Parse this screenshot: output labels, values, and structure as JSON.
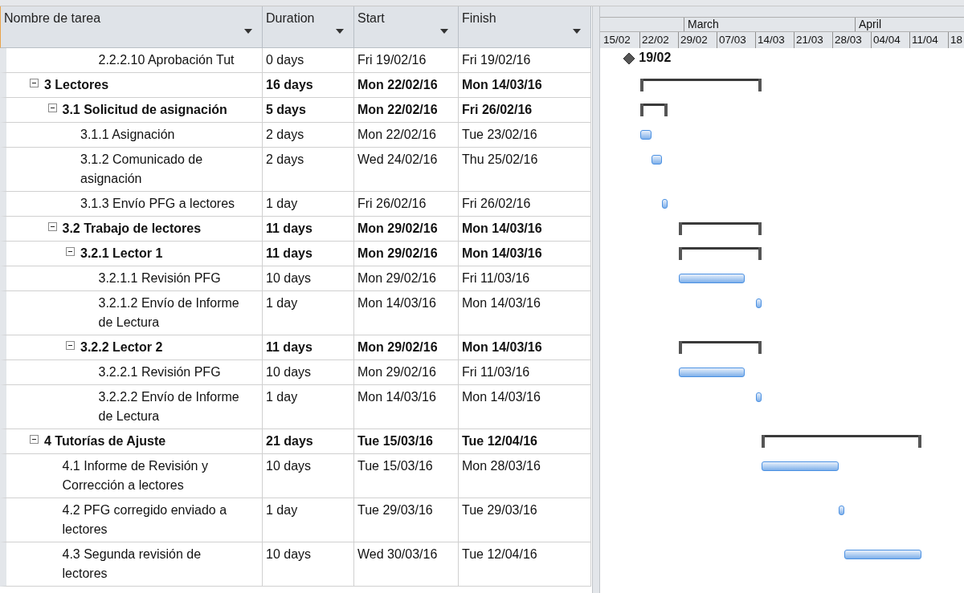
{
  "table": {
    "columns": [
      {
        "label": "Nombre de tarea"
      },
      {
        "label": "Duration"
      },
      {
        "label": "Start"
      },
      {
        "label": "Finish"
      }
    ]
  },
  "timescale": {
    "months": [
      "March",
      "April"
    ],
    "weeks": [
      "15/02",
      "22/02",
      "29/02",
      "07/03",
      "14/03",
      "21/03",
      "28/03",
      "04/04",
      "11/04",
      "18"
    ]
  },
  "scrolled_task": {
    "name": "2.2.2.10 Aprobación Tut",
    "duration": "0 days",
    "start": "Fri 19/02/16",
    "finish": "Fri 19/02/16",
    "kind": "milestone",
    "milestone_label": "19/02"
  },
  "tasks": [
    {
      "name": "3 Lectores",
      "duration": "16 days",
      "start": "Mon 22/02/16",
      "finish": "Mon 14/03/16",
      "kind": "summary",
      "expanded": true,
      "children": [
        {
          "name": "3.1 Solicitud de asignación",
          "duration": "5 days",
          "start": "Mon 22/02/16",
          "finish": "Fri 26/02/16",
          "kind": "summary",
          "expanded": true,
          "children": [
            {
              "name": "3.1.1 Asignación",
              "duration": "2 days",
              "start": "Mon 22/02/16",
              "finish": "Tue 23/02/16",
              "kind": "task"
            },
            {
              "name": "3.1.2 Comunicado de asignación",
              "duration": "2 days",
              "start": "Wed 24/02/16",
              "finish": "Thu 25/02/16",
              "kind": "task"
            },
            {
              "name": "3.1.3 Envío PFG a lectores",
              "duration": "1 day",
              "start": "Fri 26/02/16",
              "finish": "Fri 26/02/16",
              "kind": "task"
            }
          ]
        },
        {
          "name": "3.2 Trabajo de lectores",
          "duration": "11 days",
          "start": "Mon 29/02/16",
          "finish": "Mon 14/03/16",
          "kind": "summary",
          "expanded": true,
          "children": [
            {
              "name": "3.2.1 Lector 1",
              "duration": "11 days",
              "start": "Mon 29/02/16",
              "finish": "Mon 14/03/16",
              "kind": "summary",
              "expanded": true,
              "children": [
                {
                  "name": "3.2.1.1 Revisión PFG",
                  "duration": "10 days",
                  "start": "Mon 29/02/16",
                  "finish": "Fri 11/03/16",
                  "kind": "task"
                },
                {
                  "name": "3.2.1.2 Envío de Informe de Lectura",
                  "duration": "1 day",
                  "start": "Mon 14/03/16",
                  "finish": "Mon 14/03/16",
                  "kind": "task"
                }
              ]
            },
            {
              "name": "3.2.2 Lector 2",
              "duration": "11 days",
              "start": "Mon 29/02/16",
              "finish": "Mon 14/03/16",
              "kind": "summary",
              "expanded": true,
              "children": [
                {
                  "name": "3.2.2.1 Revisión PFG",
                  "duration": "10 days",
                  "start": "Mon 29/02/16",
                  "finish": "Fri 11/03/16",
                  "kind": "task"
                },
                {
                  "name": "3.2.2.2 Envío de Informe de Lectura",
                  "duration": "1 day",
                  "start": "Mon 14/03/16",
                  "finish": "Mon 14/03/16",
                  "kind": "task"
                }
              ]
            }
          ]
        }
      ]
    },
    {
      "name": "4 Tutorías de Ajuste",
      "duration": "21 days",
      "start": "Tue 15/03/16",
      "finish": "Tue 12/04/16",
      "kind": "summary",
      "expanded": true,
      "children": [
        {
          "name": "4.1 Informe de Revisión y Corrección a lectores",
          "duration": "10 days",
          "start": "Tue 15/03/16",
          "finish": "Mon 28/03/16",
          "kind": "task"
        },
        {
          "name": "4.2 PFG corregido enviado a lectores",
          "duration": "1 day",
          "start": "Tue 29/03/16",
          "finish": "Tue 29/03/16",
          "kind": "task"
        },
        {
          "name": "4.3 Segunda revisión de lectores",
          "duration": "10 days",
          "start": "Wed 30/03/16",
          "finish": "Tue 12/04/16",
          "kind": "task"
        }
      ]
    }
  ]
}
